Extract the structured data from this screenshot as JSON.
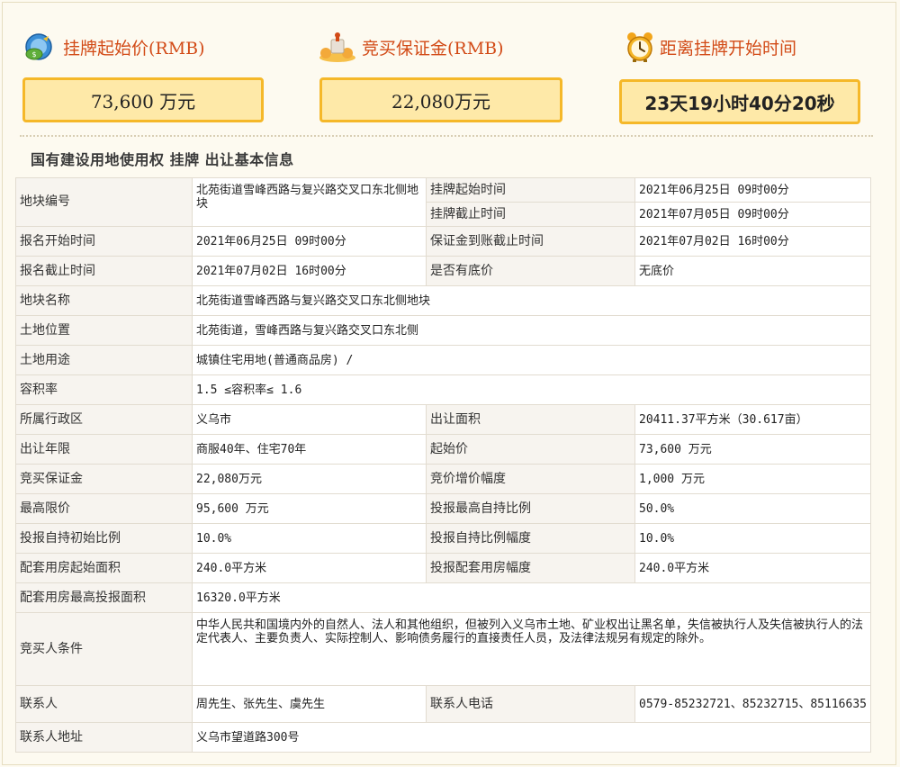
{
  "header": {
    "start_price_label": "挂牌起始价(RMB)",
    "deposit_label": "竞买保证金(RMB)",
    "countdown_label": "距离挂牌开始时间",
    "start_price_value": "73,600 万元",
    "deposit_value": "22,080万元",
    "countdown_value": "23天19小时40分20秒"
  },
  "section_title": "国有建设用地使用权 挂牌 出让基本信息",
  "table": {
    "parcel_no_label": "地块编号",
    "parcel_no_value": "北苑街道雪峰西路与复兴路交叉口东北侧地块",
    "listing_start_label": "挂牌起始时间",
    "listing_start_value": "2021年06月25日 09时00分",
    "listing_end_label": "挂牌截止时间",
    "listing_end_value": "2021年07月05日 09时00分",
    "reg_start_label": "报名开始时间",
    "reg_start_value": "2021年06月25日 09时00分",
    "deposit_deadline_label": "保证金到账截止时间",
    "deposit_deadline_value": "2021年07月02日 16时00分",
    "reg_end_label": "报名截止时间",
    "reg_end_value": "2021年07月02日 16时00分",
    "reserve_label": "是否有底价",
    "reserve_value": "无底价",
    "parcel_name_label": "地块名称",
    "parcel_name_value": "北苑街道雪峰西路与复兴路交叉口东北侧地块",
    "location_label": "土地位置",
    "location_value": "北苑街道，雪峰西路与复兴路交叉口东北侧",
    "usage_label": "土地用途",
    "usage_value": "城镇住宅用地(普通商品房) /",
    "far_label": "容积率",
    "far_value": "1.5 ≤容积率≤ 1.6",
    "district_label": "所属行政区",
    "district_value": "义乌市",
    "area_label": "出让面积",
    "area_value": "20411.37平方米（30.617亩）",
    "term_label": "出让年限",
    "term_value": "商服40年、住宅70年",
    "start_price_label": "起始价",
    "start_price_value": "73,600 万元",
    "deposit_label": "竞买保证金",
    "deposit_value": "22,080万元",
    "increment_label": "竞价增价幅度",
    "increment_value": "1,000 万元",
    "max_price_label": "最高限价",
    "max_price_value": "95,600 万元",
    "max_self_label": "投报最高自持比例",
    "max_self_value": "50.0%",
    "init_self_label": "投报自持初始比例",
    "init_self_value": "10.0%",
    "self_step_label": "投报自持比例幅度",
    "self_step_value": "10.0%",
    "housing_start_label": "配套用房起始面积",
    "housing_start_value": "240.0平方米",
    "housing_step_label": "投报配套用房幅度",
    "housing_step_value": "240.0平方米",
    "housing_max_label": "配套用房最高投报面积",
    "housing_max_value": "16320.0平方米",
    "bidder_label": "竞买人条件",
    "bidder_value": "中华人民共和国境内外的自然人、法人和其他组织，但被列入义乌市土地、矿业权出让黑名单，失信被执行人及失信被执行人的法定代表人、主要负责人、实际控制人、影响债务履行的直接责任人员，及法律法规另有规定的除外。",
    "contact_label": "联系人",
    "contact_value": "周先生、张先生、虞先生",
    "phone_label": "联系人电话",
    "phone_value": "0579-85232721、85232715、85116635",
    "address_label": "联系人地址",
    "address_value": "义乌市望道路300号"
  },
  "colors": {
    "accent_text": "#d24a16",
    "box_fill": "#fee9a8",
    "box_border": "#f5b829"
  },
  "icons": [
    "money-icon",
    "gift-icon",
    "alarm-clock-icon"
  ]
}
